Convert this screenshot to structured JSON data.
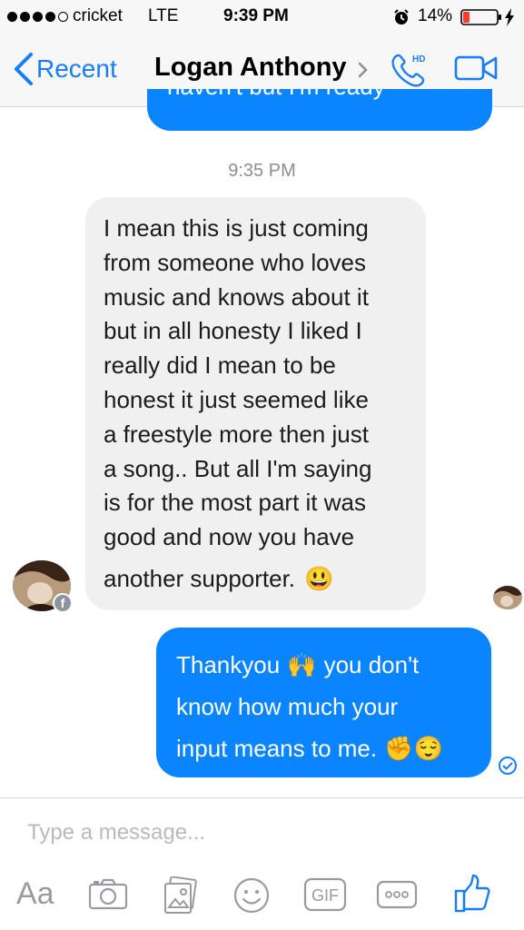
{
  "status_bar": {
    "carrier": "cricket",
    "network": "LTE",
    "time": "9:39 PM",
    "battery": "14%",
    "signal_bars": 4,
    "icons": [
      "alarm-icon",
      "battery-icon",
      "charging-icon"
    ]
  },
  "nav": {
    "back_label": "Recent",
    "contact_name": "Logan Anthony",
    "phone_badge": "HD",
    "icons": [
      "back-chevron-icon",
      "chevron-right-icon",
      "phone-icon",
      "video-camera-icon"
    ]
  },
  "conversation": {
    "partial_text": "haven't but I'm ready",
    "timestamp": "9:35 PM",
    "incoming_message": {
      "lines": [
        "I mean this is just coming",
        "from someone who loves",
        "music and knows about it",
        "but in all honesty I liked I",
        "really did I mean to be",
        "honest it just seemed like",
        "a freestyle more then just",
        "a song.. But all I'm saying",
        "is for the most part it was",
        "good and now you have",
        "another supporter."
      ],
      "emoji": "😃"
    },
    "outgoing_message": {
      "lines": [
        {
          "text": "Thankyou",
          "emoji": "🙌",
          "after": "you don't"
        },
        {
          "text": "know how much your",
          "emoji": "",
          "after": ""
        },
        {
          "text": "input means to me.",
          "emoji": "✊😌",
          "after": ""
        }
      ]
    },
    "sender_badge": "f"
  },
  "composer": {
    "placeholder": "Type a message...",
    "aa_label": "Aa",
    "gif_label": "GIF",
    "tools": [
      "camera-icon",
      "photo-gallery-icon",
      "sticker-icon",
      "gif-icon",
      "more-icon",
      "like-icon"
    ]
  },
  "colors": {
    "accent": "#1a7df5",
    "outgoing_bubble": "#0b84ff",
    "incoming_bubble": "#f1f0f0",
    "muted": "#8e8e93"
  }
}
